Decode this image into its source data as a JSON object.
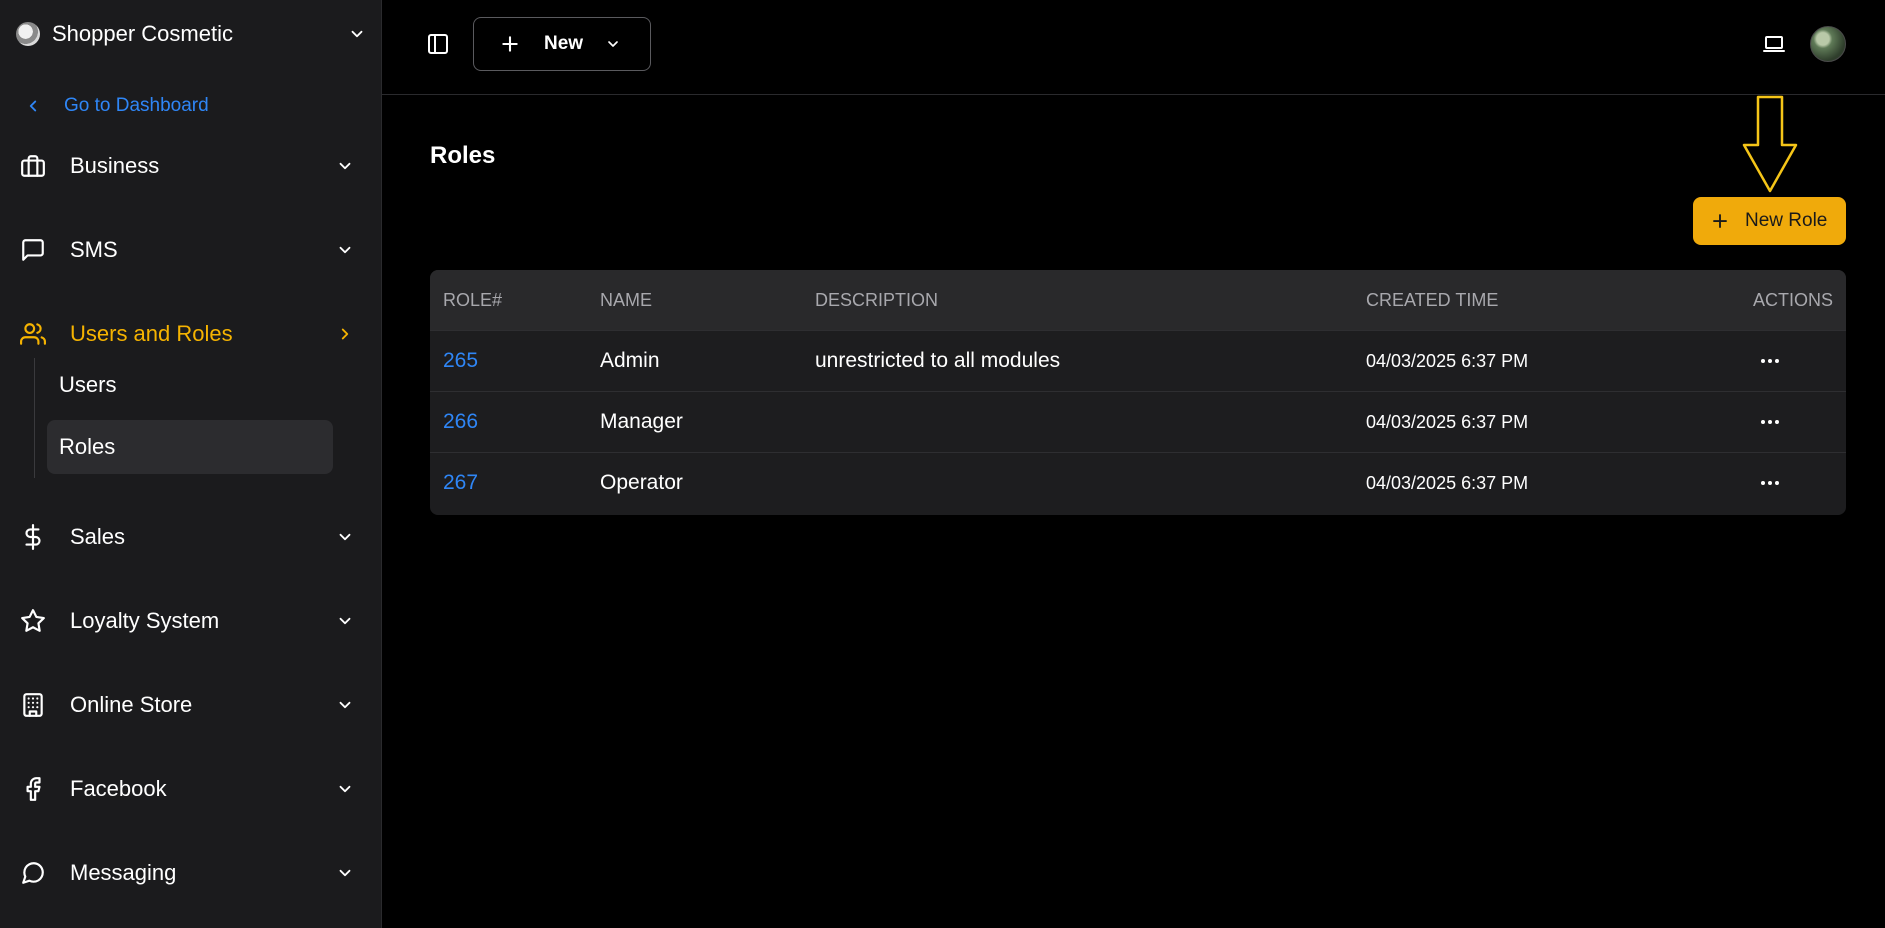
{
  "sidebar": {
    "brand": "Shopper Cosmetic",
    "back_link": "Go to Dashboard",
    "items": [
      {
        "label": "Business",
        "icon": "briefcase-icon"
      },
      {
        "label": "SMS",
        "icon": "message-square-icon"
      },
      {
        "label": "Users and Roles",
        "icon": "users-icon",
        "active": true
      },
      {
        "label": "Sales",
        "icon": "dollar-icon"
      },
      {
        "label": "Loyalty System",
        "icon": "star-icon"
      },
      {
        "label": "Online Store",
        "icon": "building-icon"
      },
      {
        "label": "Facebook",
        "icon": "facebook-icon"
      },
      {
        "label": "Messaging",
        "icon": "chat-bubble-icon"
      }
    ],
    "subitems": [
      {
        "label": "Users"
      },
      {
        "label": "Roles",
        "selected": true
      }
    ]
  },
  "topbar": {
    "new_label": "New"
  },
  "page": {
    "title": "Roles",
    "new_role_label": "New Role"
  },
  "table": {
    "headers": [
      "ROLE#",
      "NAME",
      "DESCRIPTION",
      "CREATED TIME",
      "ACTIONS"
    ],
    "rows": [
      {
        "role": "265",
        "name": "Admin",
        "description": "unrestricted to all modules",
        "created": "04/03/2025 6:37 PM"
      },
      {
        "role": "266",
        "name": "Manager",
        "description": "",
        "created": "04/03/2025 6:37 PM"
      },
      {
        "role": "267",
        "name": "Operator",
        "description": "",
        "created": "04/03/2025 6:37 PM"
      }
    ]
  },
  "colors": {
    "accent": "#f5b301",
    "link": "#2f86f6",
    "sidebar_bg": "#1b1b1d",
    "primary_button": "#f0aa0b"
  }
}
